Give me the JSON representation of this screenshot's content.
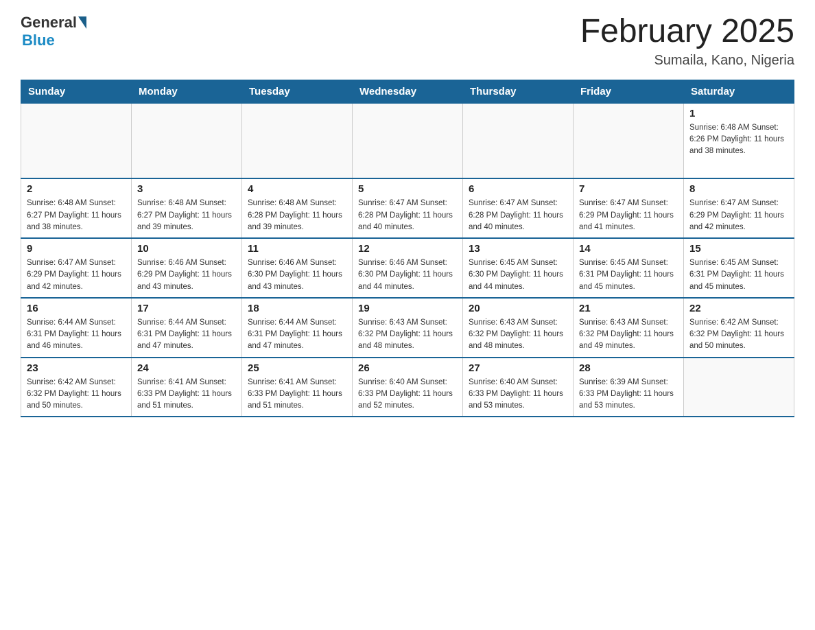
{
  "header": {
    "logo_general": "General",
    "logo_blue": "Blue",
    "title": "February 2025",
    "subtitle": "Sumaila, Kano, Nigeria"
  },
  "days_of_week": [
    "Sunday",
    "Monday",
    "Tuesday",
    "Wednesday",
    "Thursday",
    "Friday",
    "Saturday"
  ],
  "weeks": [
    [
      {
        "day": "",
        "info": ""
      },
      {
        "day": "",
        "info": ""
      },
      {
        "day": "",
        "info": ""
      },
      {
        "day": "",
        "info": ""
      },
      {
        "day": "",
        "info": ""
      },
      {
        "day": "",
        "info": ""
      },
      {
        "day": "1",
        "info": "Sunrise: 6:48 AM\nSunset: 6:26 PM\nDaylight: 11 hours\nand 38 minutes."
      }
    ],
    [
      {
        "day": "2",
        "info": "Sunrise: 6:48 AM\nSunset: 6:27 PM\nDaylight: 11 hours\nand 38 minutes."
      },
      {
        "day": "3",
        "info": "Sunrise: 6:48 AM\nSunset: 6:27 PM\nDaylight: 11 hours\nand 39 minutes."
      },
      {
        "day": "4",
        "info": "Sunrise: 6:48 AM\nSunset: 6:28 PM\nDaylight: 11 hours\nand 39 minutes."
      },
      {
        "day": "5",
        "info": "Sunrise: 6:47 AM\nSunset: 6:28 PM\nDaylight: 11 hours\nand 40 minutes."
      },
      {
        "day": "6",
        "info": "Sunrise: 6:47 AM\nSunset: 6:28 PM\nDaylight: 11 hours\nand 40 minutes."
      },
      {
        "day": "7",
        "info": "Sunrise: 6:47 AM\nSunset: 6:29 PM\nDaylight: 11 hours\nand 41 minutes."
      },
      {
        "day": "8",
        "info": "Sunrise: 6:47 AM\nSunset: 6:29 PM\nDaylight: 11 hours\nand 42 minutes."
      }
    ],
    [
      {
        "day": "9",
        "info": "Sunrise: 6:47 AM\nSunset: 6:29 PM\nDaylight: 11 hours\nand 42 minutes."
      },
      {
        "day": "10",
        "info": "Sunrise: 6:46 AM\nSunset: 6:29 PM\nDaylight: 11 hours\nand 43 minutes."
      },
      {
        "day": "11",
        "info": "Sunrise: 6:46 AM\nSunset: 6:30 PM\nDaylight: 11 hours\nand 43 minutes."
      },
      {
        "day": "12",
        "info": "Sunrise: 6:46 AM\nSunset: 6:30 PM\nDaylight: 11 hours\nand 44 minutes."
      },
      {
        "day": "13",
        "info": "Sunrise: 6:45 AM\nSunset: 6:30 PM\nDaylight: 11 hours\nand 44 minutes."
      },
      {
        "day": "14",
        "info": "Sunrise: 6:45 AM\nSunset: 6:31 PM\nDaylight: 11 hours\nand 45 minutes."
      },
      {
        "day": "15",
        "info": "Sunrise: 6:45 AM\nSunset: 6:31 PM\nDaylight: 11 hours\nand 45 minutes."
      }
    ],
    [
      {
        "day": "16",
        "info": "Sunrise: 6:44 AM\nSunset: 6:31 PM\nDaylight: 11 hours\nand 46 minutes."
      },
      {
        "day": "17",
        "info": "Sunrise: 6:44 AM\nSunset: 6:31 PM\nDaylight: 11 hours\nand 47 minutes."
      },
      {
        "day": "18",
        "info": "Sunrise: 6:44 AM\nSunset: 6:31 PM\nDaylight: 11 hours\nand 47 minutes."
      },
      {
        "day": "19",
        "info": "Sunrise: 6:43 AM\nSunset: 6:32 PM\nDaylight: 11 hours\nand 48 minutes."
      },
      {
        "day": "20",
        "info": "Sunrise: 6:43 AM\nSunset: 6:32 PM\nDaylight: 11 hours\nand 48 minutes."
      },
      {
        "day": "21",
        "info": "Sunrise: 6:43 AM\nSunset: 6:32 PM\nDaylight: 11 hours\nand 49 minutes."
      },
      {
        "day": "22",
        "info": "Sunrise: 6:42 AM\nSunset: 6:32 PM\nDaylight: 11 hours\nand 50 minutes."
      }
    ],
    [
      {
        "day": "23",
        "info": "Sunrise: 6:42 AM\nSunset: 6:32 PM\nDaylight: 11 hours\nand 50 minutes."
      },
      {
        "day": "24",
        "info": "Sunrise: 6:41 AM\nSunset: 6:33 PM\nDaylight: 11 hours\nand 51 minutes."
      },
      {
        "day": "25",
        "info": "Sunrise: 6:41 AM\nSunset: 6:33 PM\nDaylight: 11 hours\nand 51 minutes."
      },
      {
        "day": "26",
        "info": "Sunrise: 6:40 AM\nSunset: 6:33 PM\nDaylight: 11 hours\nand 52 minutes."
      },
      {
        "day": "27",
        "info": "Sunrise: 6:40 AM\nSunset: 6:33 PM\nDaylight: 11 hours\nand 53 minutes."
      },
      {
        "day": "28",
        "info": "Sunrise: 6:39 AM\nSunset: 6:33 PM\nDaylight: 11 hours\nand 53 minutes."
      },
      {
        "day": "",
        "info": ""
      }
    ]
  ]
}
